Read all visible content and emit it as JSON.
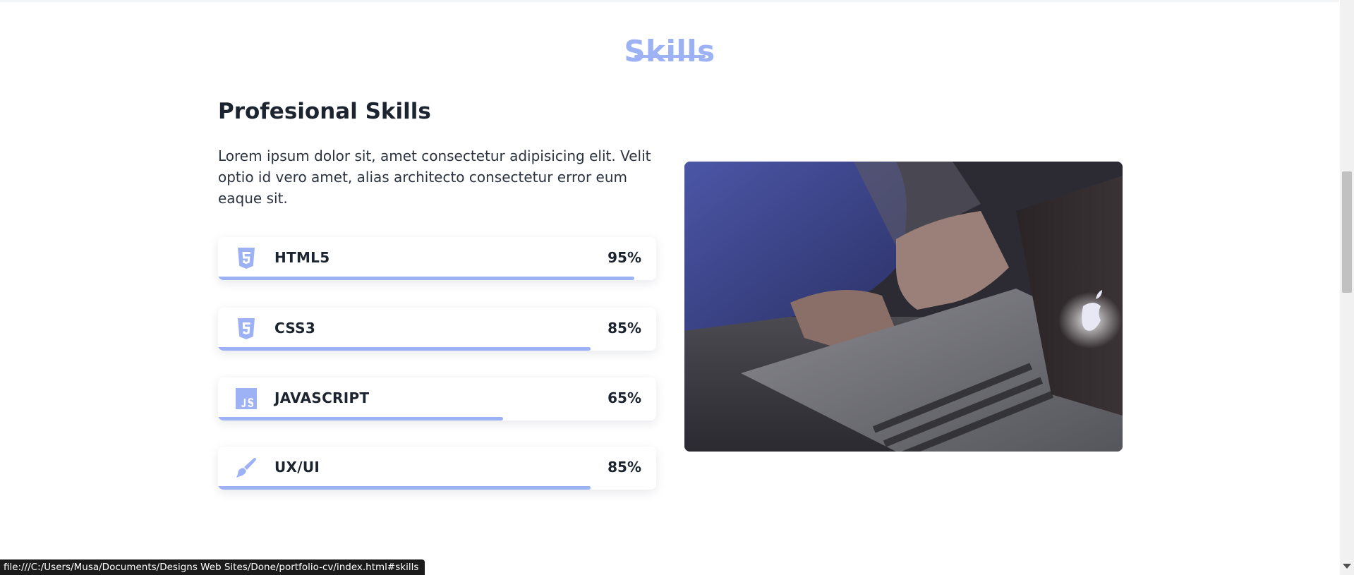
{
  "section": {
    "title": "Skills",
    "subheading": "Profesional Skills",
    "description": "Lorem ipsum dolor sit, amet consectetur adipisicing elit. Velit optio id vero amet, alias architecto consectetur error eum eaque sit."
  },
  "skills": [
    {
      "name": "HTML5",
      "percent_label": "95%",
      "level": 0.95,
      "icon": "html5-icon"
    },
    {
      "name": "CSS3",
      "percent_label": "85%",
      "level": 0.85,
      "icon": "css3-icon"
    },
    {
      "name": "JAVASCRIPT",
      "percent_label": "65%",
      "level": 0.65,
      "icon": "javascript-icon"
    },
    {
      "name": "UX/UI",
      "percent_label": "85%",
      "level": 0.85,
      "icon": "paintbrush-icon"
    }
  ],
  "image": {
    "subject": "person typing on a laptop"
  },
  "status_bar": {
    "url": "file:///C:/Users/Musa/Documents/Designs Web Sites/Done/portfolio-cv/index.html#skills"
  },
  "colors": {
    "accent": "#9db2f5",
    "heading": "#1c2430",
    "text": "#2b3340"
  }
}
